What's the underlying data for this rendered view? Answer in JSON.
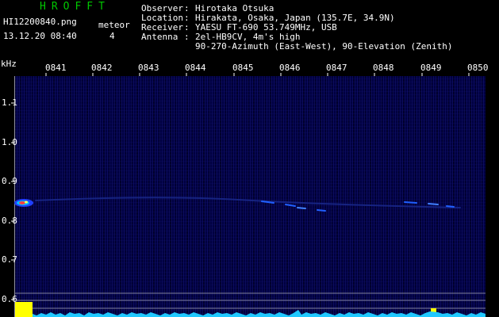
{
  "header": {
    "logo": "HROFFT",
    "filename": "HI12200840.png",
    "datetime": "13.12.20 08:40",
    "meteor_label": "meteor",
    "meteor_count": "4"
  },
  "station_info": [
    {
      "key": "Observer",
      "value": "Hirotaka Otsuka"
    },
    {
      "key": "Location",
      "value": "Hirakata, Osaka, Japan (135.7E, 34.9N)"
    },
    {
      "key": "Receiver",
      "value": "YAESU FT-690 53.749MHz, USB"
    },
    {
      "key": "Antenna",
      "value": "2el-HB9CV, 4m's high"
    },
    {
      "key": "",
      "value": "90-270-Azimuth (East-West), 90-Elevation (Zenith)"
    }
  ],
  "axis": {
    "unit_label": "kHz",
    "time_ticks": [
      "0841",
      "0842",
      "0843",
      "0844",
      "0845",
      "0846",
      "0847",
      "0848",
      "0849",
      "0850"
    ],
    "freq_ticks": [
      "1.1",
      "1.0",
      "0.9",
      "0.8",
      "0.7",
      "0.6"
    ]
  },
  "colors": {
    "logo": "#00c800",
    "text": "#ffffff",
    "background": "#000000",
    "spectrogram_bg": "#000040",
    "trace": "#2060ff",
    "level_bar": "#ffff00",
    "noise_floor": "#20c8ff"
  }
}
